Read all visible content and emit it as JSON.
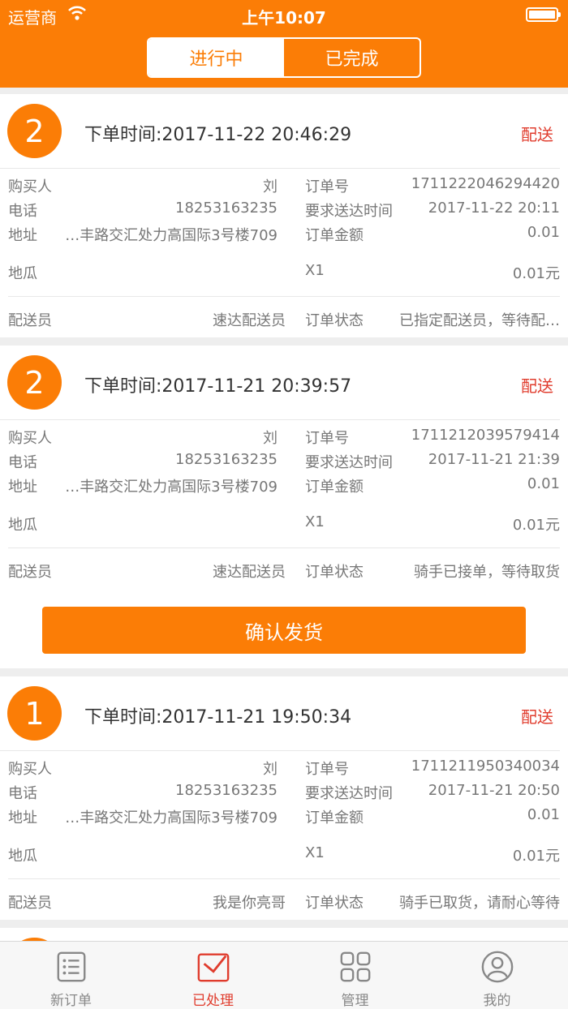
{
  "status": {
    "carrier": "运营商",
    "time": "上午10:07"
  },
  "segment": {
    "active": "进行中",
    "inactive": "已完成"
  },
  "labels": {
    "buyer": "购买人",
    "phone": "电话",
    "address": "地址",
    "order_no": "订单号",
    "delivery_time": "要求送达时间",
    "amount": "订单金额",
    "courier": "配送员",
    "order_status": "订单状态"
  },
  "orders": [
    {
      "badge": "2",
      "order_time": "下单时间:2017-11-22 20:46:29",
      "type": "配送",
      "buyer": "刘",
      "phone": "18253163235",
      "address": "…丰路交汇处力高国际3号楼709",
      "order_no": "1711222046294420",
      "delivery_time": "2017-11-22 20:11",
      "amount": "0.01",
      "item": "地瓜",
      "qty": "X1",
      "price": "0.01元",
      "courier": "速达配送员",
      "status": "已指定配送员，等待配…"
    },
    {
      "badge": "2",
      "order_time": "下单时间:2017-11-21 20:39:57",
      "type": "配送",
      "buyer": "刘",
      "phone": "18253163235",
      "address": "…丰路交汇处力高国际3号楼709",
      "order_no": "1711212039579414",
      "delivery_time": "2017-11-21 21:39",
      "amount": "0.01",
      "item": "地瓜",
      "qty": "X1",
      "price": "0.01元",
      "courier": "速达配送员",
      "status": "骑手已接单，等待取货",
      "button": "确认发货"
    },
    {
      "badge": "1",
      "order_time": "下单时间:2017-11-21 19:50:34",
      "type": "配送",
      "buyer": "刘",
      "phone": "18253163235",
      "address": "…丰路交汇处力高国际3号楼709",
      "order_no": "1711211950340034",
      "delivery_time": "2017-11-21 20:50",
      "amount": "0.01",
      "item": "地瓜",
      "qty": "X1",
      "price": "0.01元",
      "courier": "我是你亮哥",
      "status": "骑手已取货，请耐心等待"
    }
  ],
  "tabs": [
    {
      "label": "新订单",
      "icon": "list-icon"
    },
    {
      "label": "已处理",
      "icon": "envelope-check-icon"
    },
    {
      "label": "管理",
      "icon": "grid-icon"
    },
    {
      "label": "我的",
      "icon": "user-icon"
    }
  ],
  "colors": {
    "accent": "#fb7d06",
    "red": "#e03c2d"
  }
}
